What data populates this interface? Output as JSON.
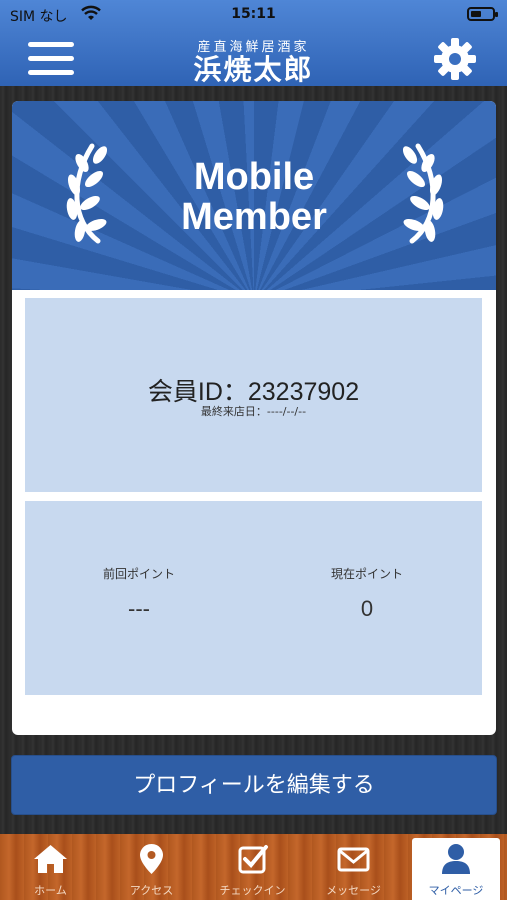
{
  "status_bar": {
    "carrier": "SIM なし",
    "time": "15:11"
  },
  "header": {
    "logo_subtitle": "産直海鮮居酒家",
    "logo_title": "浜焼太郎",
    "menu_icon": "hamburger-menu-icon",
    "settings_icon": "gear-icon"
  },
  "card": {
    "banner_title_line1": "Mobile",
    "banner_title_line2": "Member",
    "member_id": "会員ID：23237902",
    "last_visit": "最終来店日：----/--/--",
    "previous_points_label": "前回ポイント",
    "previous_points_value": "---",
    "current_points_label": "現在ポイント",
    "current_points_value": "0"
  },
  "edit_profile_label": "プロフィールを編集する",
  "tabs": [
    {
      "label": "ホーム",
      "icon": "home-icon",
      "active": false
    },
    {
      "label": "アクセス",
      "icon": "map-pin-icon",
      "active": false
    },
    {
      "label": "チェックイン",
      "icon": "checkbox-icon",
      "active": false
    },
    {
      "label": "メッセージ",
      "icon": "envelope-icon",
      "active": false
    },
    {
      "label": "マイページ",
      "icon": "user-icon",
      "active": true
    }
  ],
  "colors": {
    "header_blue": "#2f63b5",
    "panel_blue": "#c8d9ef",
    "button_blue": "#2f5ea6",
    "tab_wood": "#b0571f"
  }
}
